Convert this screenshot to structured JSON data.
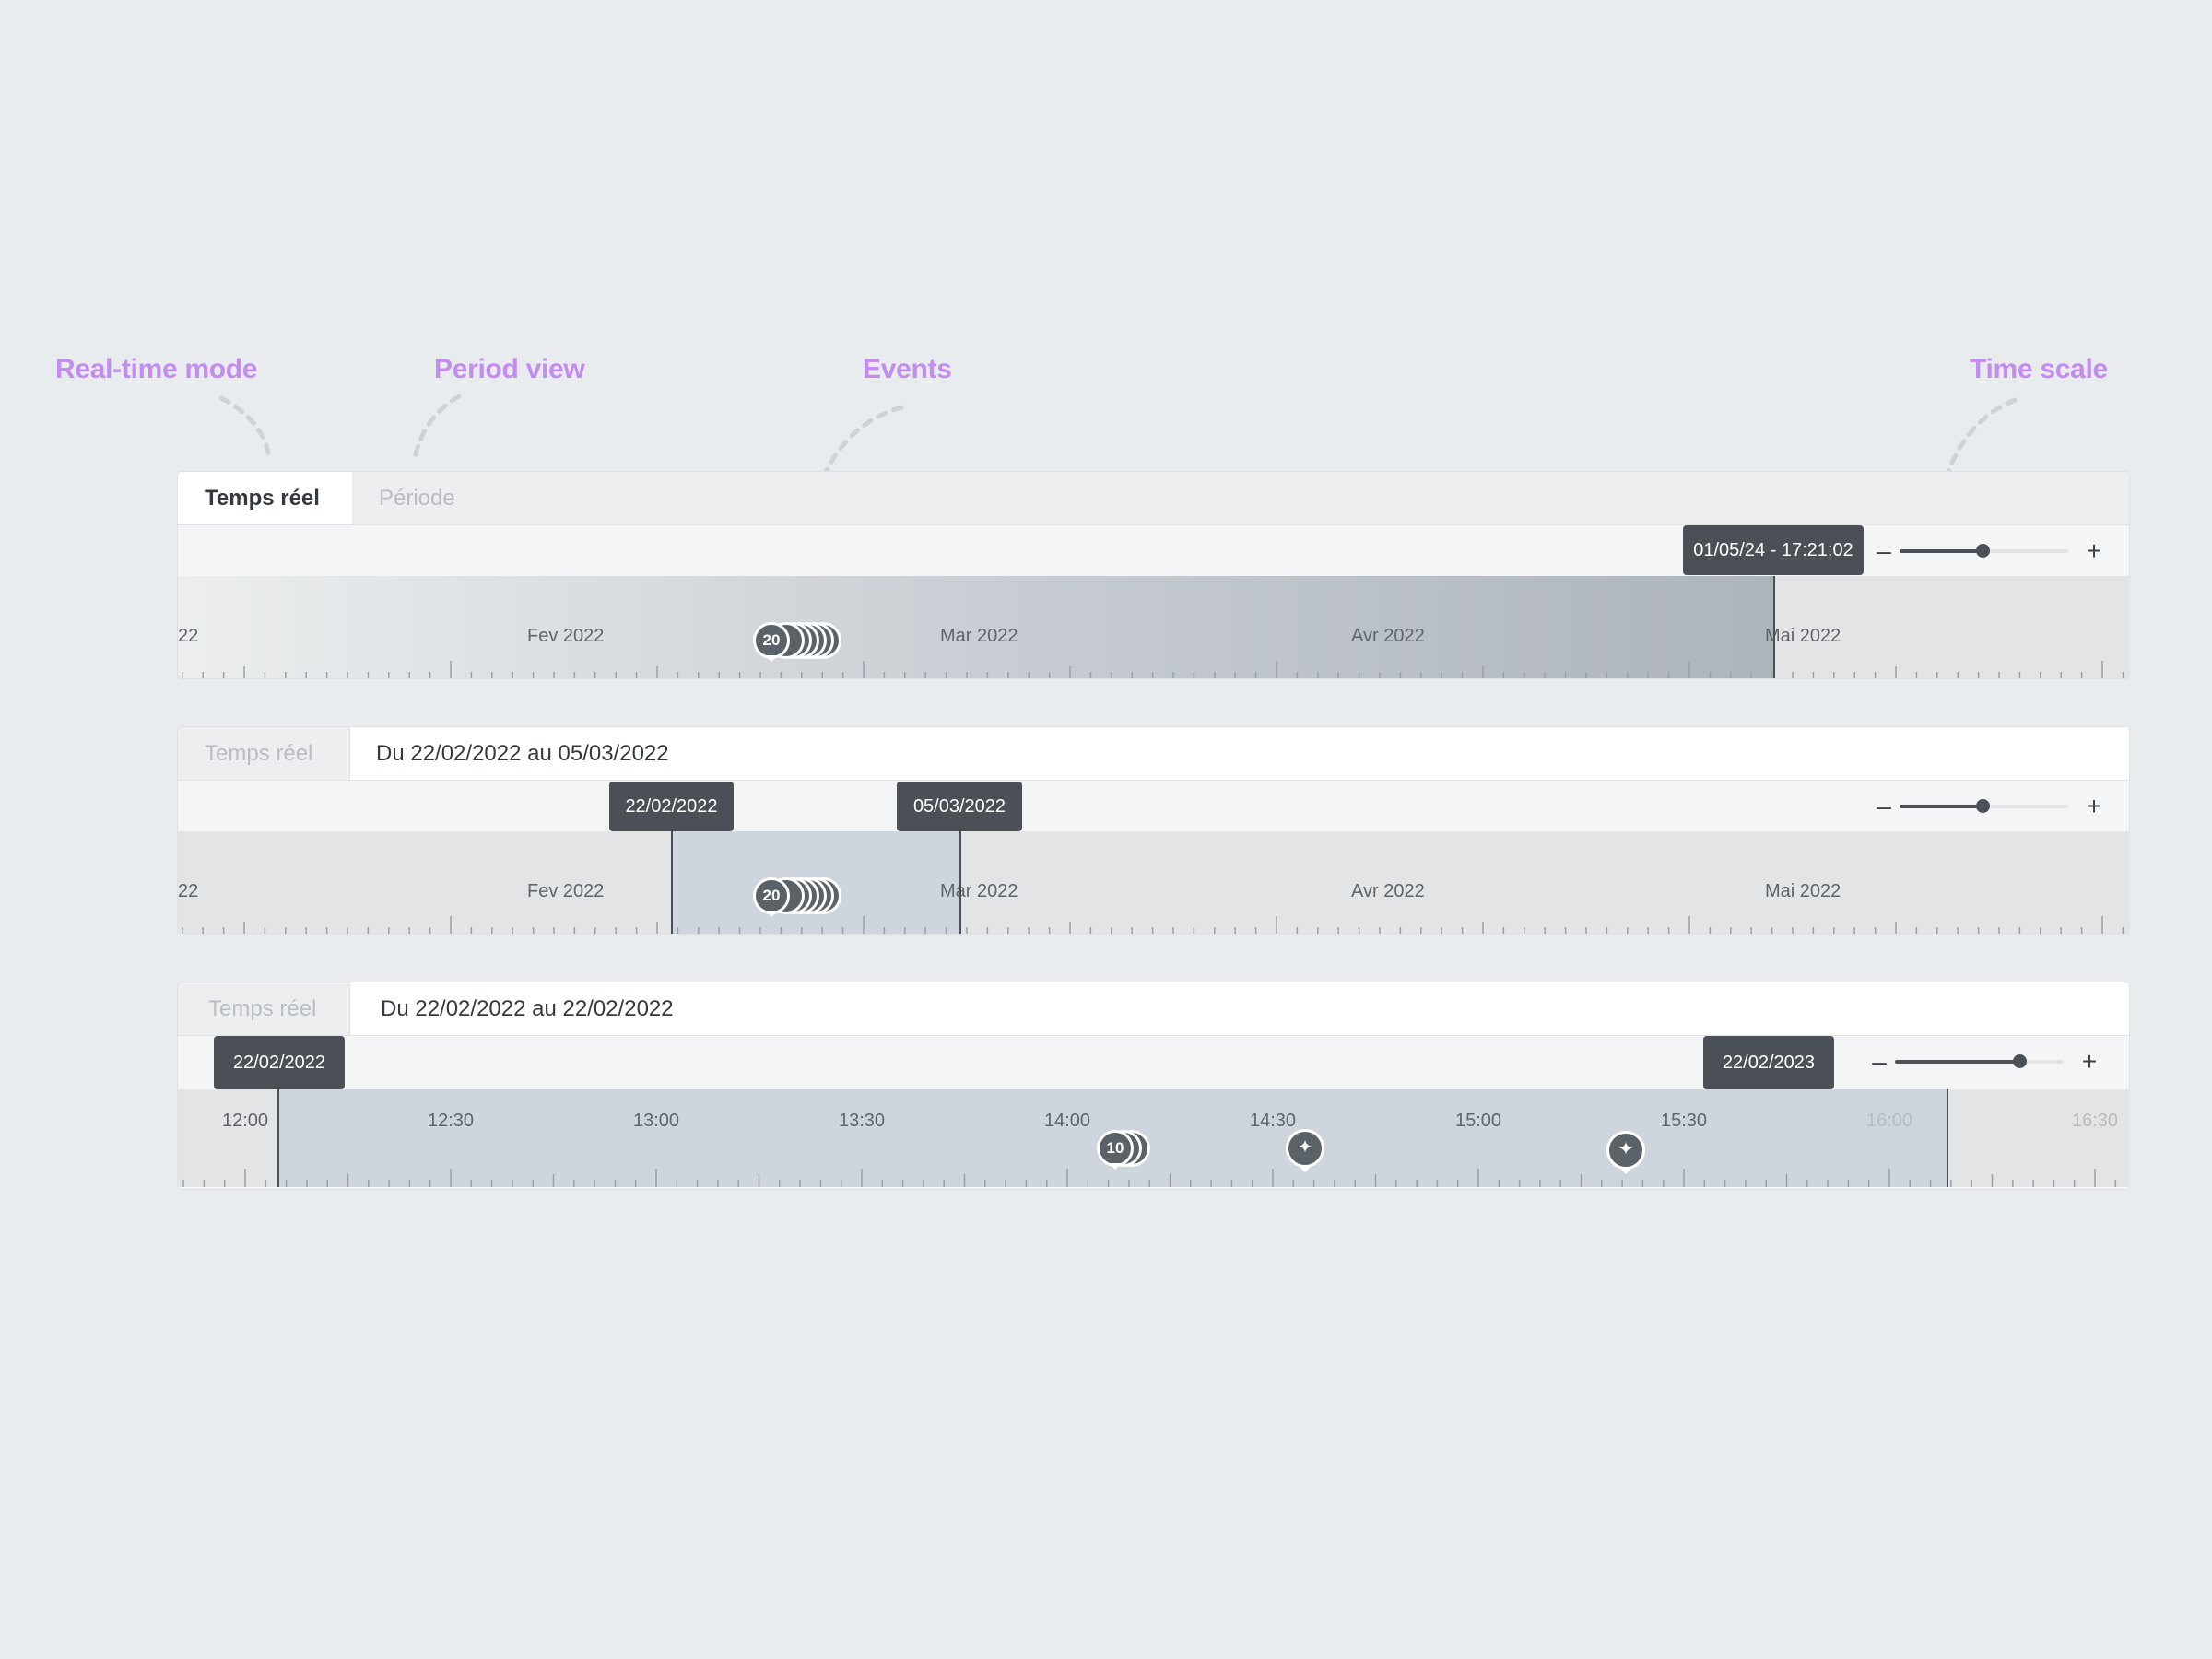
{
  "annotations": {
    "realtime": "Real-time mode",
    "period": "Period view",
    "events": "Events",
    "timescale": "Time scale"
  },
  "colors": {
    "annotation": "#c28cf0",
    "flag_bg": "#4a5056",
    "selection": "#cfd5dc",
    "scale_bg": "#e3e4e5"
  },
  "widget1": {
    "tab_realtime": "Temps réel",
    "tab_period": "Période",
    "cursor_label": "01/05/24 - 17:21:02",
    "zoom_minus": "–",
    "zoom_plus": "+",
    "zoom_level": 0.49,
    "months": [
      "22",
      "Fev 2022",
      "Mar 2022",
      "Avr 2022",
      "Mai 2022"
    ],
    "event_cluster_count": "20"
  },
  "widget2": {
    "tab_realtime": "Temps réel",
    "period_text": "Du 22/02/2022 au 05/03/2022",
    "start_label": "22/02/2022",
    "end_label": "05/03/2022",
    "zoom_minus": "–",
    "zoom_plus": "+",
    "zoom_level": 0.49,
    "months": [
      "22",
      "Fev 2022",
      "Mar 2022",
      "Avr 2022",
      "Mai 2022"
    ],
    "event_cluster_count": "20"
  },
  "widget3": {
    "tab_realtime": "Temps réel",
    "period_text": "Du 22/02/2022 au 22/02/2022",
    "start_label": "22/02/2022",
    "end_label": "22/02/2023",
    "zoom_minus": "–",
    "zoom_plus": "+",
    "zoom_level": 0.74,
    "times": [
      "12:00",
      "12:30",
      "13:00",
      "13:30",
      "14:00",
      "14:30",
      "15:00",
      "15:30",
      "16:00",
      "16:30"
    ],
    "event_cluster_count": "10",
    "event_icon": "sparkle-icon",
    "event_glyph": "✦"
  }
}
